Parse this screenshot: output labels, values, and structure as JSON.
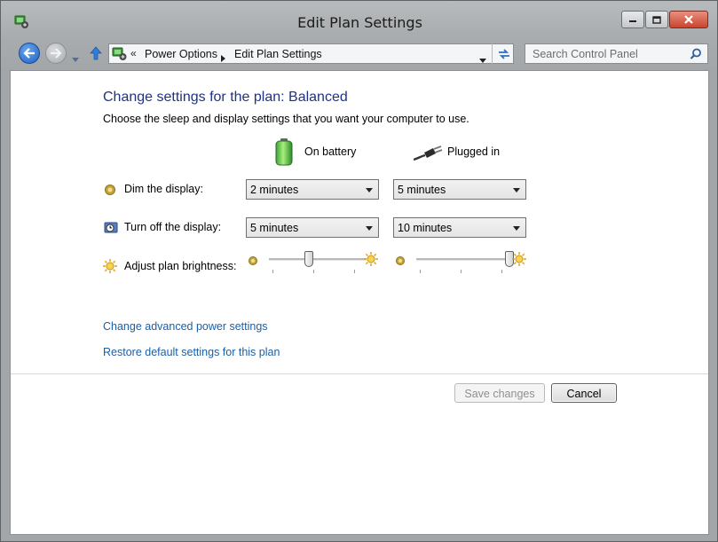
{
  "window": {
    "title": "Edit Plan Settings"
  },
  "navigation": {
    "breadcrumbs": [
      "Power Options",
      "Edit Plan Settings"
    ],
    "search_placeholder": "Search Control Panel"
  },
  "content": {
    "heading": "Change settings for the plan: Balanced",
    "subtitle": "Choose the sleep and display settings that you want your computer to use.",
    "columns": {
      "battery": "On battery",
      "plugged": "Plugged in"
    },
    "rows": {
      "dim": {
        "label": "Dim the display:",
        "battery_value": "2 minutes",
        "plugged_value": "5 minutes"
      },
      "off": {
        "label": "Turn off the display:",
        "battery_value": "5 minutes",
        "plugged_value": "10 minutes"
      },
      "brightness": {
        "label": "Adjust plan brightness:",
        "battery_level": 0.4,
        "plugged_level": 1.0
      }
    },
    "links": {
      "advanced": "Change advanced power settings",
      "restore": "Restore default settings for this plan"
    },
    "buttons": {
      "save": "Save changes",
      "cancel": "Cancel"
    }
  }
}
